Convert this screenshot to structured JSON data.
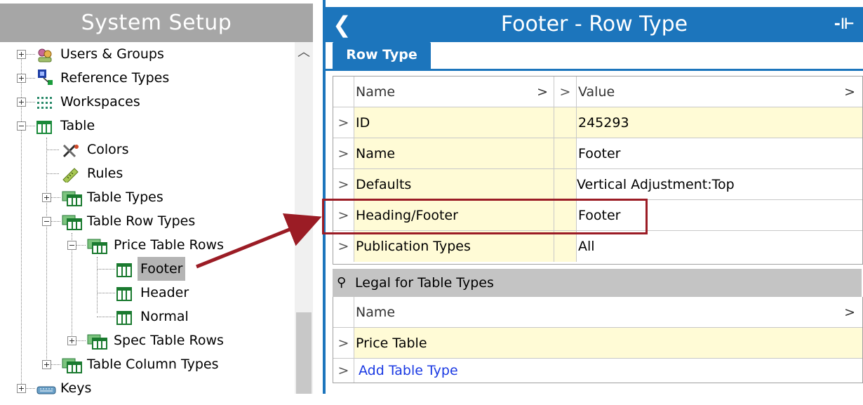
{
  "left_pane": {
    "title": "System Setup",
    "tree": [
      {
        "label": "Users & Groups",
        "icon": "users-groups-icon"
      },
      {
        "label": "Reference Types",
        "icon": "reference-types-icon"
      },
      {
        "label": "Workspaces",
        "icon": "workspaces-icon"
      },
      {
        "label": "Table",
        "icon": "table-icon"
      },
      {
        "label": "Colors",
        "icon": "colors-icon"
      },
      {
        "label": "Rules",
        "icon": "rules-icon"
      },
      {
        "label": "Table Types",
        "icon": "table-types-icon"
      },
      {
        "label": "Table Row Types",
        "icon": "table-row-types-icon"
      },
      {
        "label": "Price Table Rows",
        "icon": "price-table-rows-icon"
      },
      {
        "label": "Footer",
        "icon": "table-row-icon",
        "selected": true
      },
      {
        "label": "Header",
        "icon": "table-row-icon"
      },
      {
        "label": "Normal",
        "icon": "table-row-icon"
      },
      {
        "label": "Spec Table Rows",
        "icon": "spec-table-rows-icon"
      },
      {
        "label": "Table Column Types",
        "icon": "table-column-types-icon"
      },
      {
        "label": "Keys",
        "icon": "keys-icon"
      }
    ]
  },
  "right_pane": {
    "title": "Footer - Row Type",
    "back_icon": "chevron-left-icon",
    "pin_icon": "pin-icon",
    "tab": "Row Type",
    "properties": {
      "columns": {
        "name": "Name",
        "value": "Value"
      },
      "rows": [
        {
          "name": "ID",
          "value": "245293"
        },
        {
          "name": "Name",
          "value": "Footer"
        },
        {
          "name": "Defaults",
          "value": "Vertical Adjustment:Top"
        },
        {
          "name": "Heading/Footer",
          "value": "Footer",
          "highlighted": true
        },
        {
          "name": "Publication Types",
          "value": "All"
        }
      ]
    },
    "legal": {
      "title": "Legal for Table Types",
      "column": "Name",
      "rows": [
        "Price Table"
      ],
      "add_link": "Add Table Type"
    }
  },
  "colors": {
    "accent": "#1c75bc",
    "highlight_box": "#9b1c25",
    "cell_yellow": "#fffbd6",
    "header_gray": "#a6a6a6"
  }
}
